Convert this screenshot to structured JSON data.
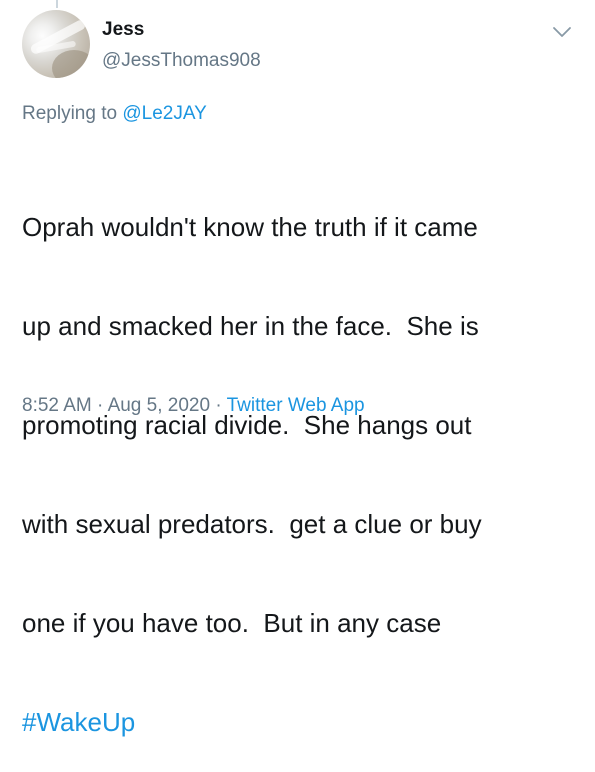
{
  "author": {
    "display_name": "Jess",
    "handle": "@JessThomas908"
  },
  "reply": {
    "prefix": "Replying to",
    "mention": "@Le2JAY"
  },
  "tweet": {
    "lines": [
      "Oprah wouldn't know the truth if it came",
      "up and smacked her in the face.  She is",
      "promoting racial divide.  She hangs out",
      "with sexual predators.  get a clue or buy",
      "one if you have too.  But in any case"
    ],
    "hashtag": "#WakeUp"
  },
  "meta": {
    "time": "8:52 AM",
    "sep1": "·",
    "date": "Aug 5, 2020",
    "sep2": "·",
    "source": "Twitter Web App"
  },
  "icons": {
    "menu": "chevron-down-icon"
  },
  "colors": {
    "link": "#1b95e0",
    "secondary_text": "#657786",
    "primary_text": "#14171a"
  }
}
